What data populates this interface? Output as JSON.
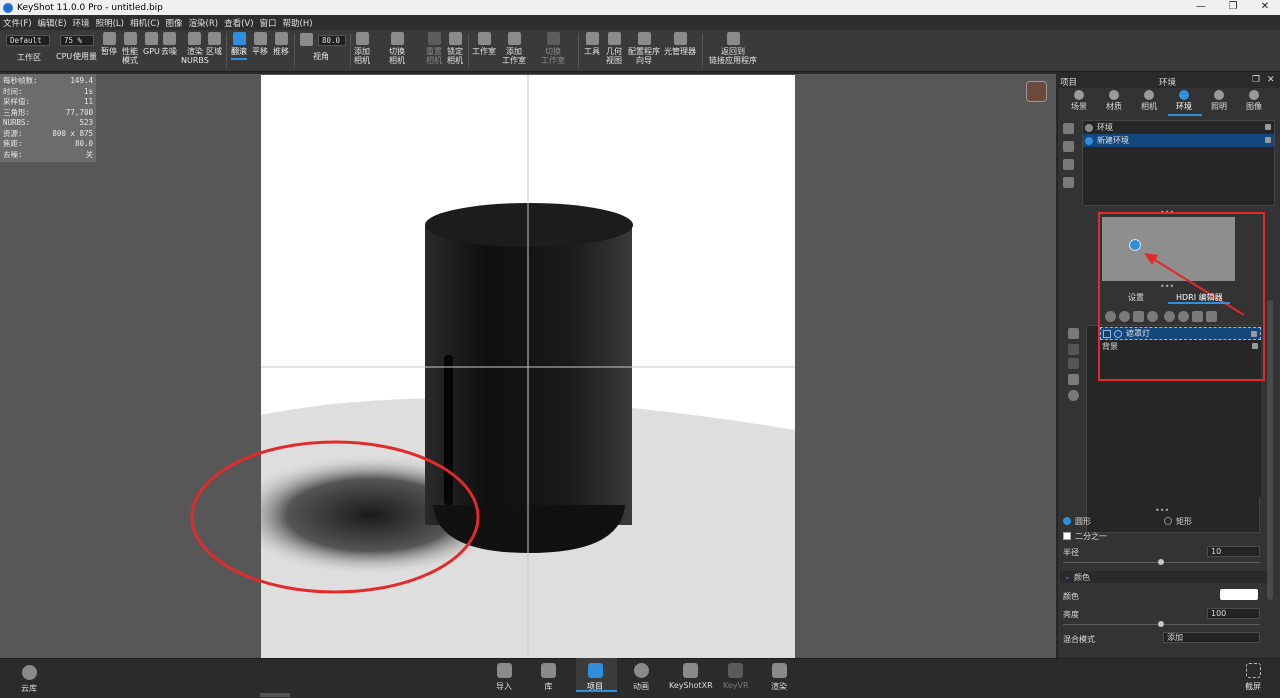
{
  "window": {
    "title": "KeyShot 11.0.0 Pro  - untitled.bip",
    "min": "—",
    "restore": "❐",
    "close": "✕"
  },
  "menu": [
    "文件(F)",
    "编辑(E)",
    "环境",
    "照明(L)",
    "相机(C)",
    "图像",
    "渲染(R)",
    "查看(V)",
    "窗口",
    "帮助(H)"
  ],
  "toolbar": {
    "preset": "Default",
    "zoom": "75 %",
    "fov": "80.0",
    "buttons": {
      "workspace": "工作区",
      "cpu": "CPU",
      "usage": "使用量",
      "pause": "暂停",
      "perf": "性能\n模式",
      "gpu": "GPU",
      "denoise": "去噪",
      "nurbs": "渲染\nNURBS",
      "region": "区域",
      "tumble": "翻滚",
      "pan": "平移",
      "dolly": "推移",
      "perspective": "视角",
      "add_camera": "添加\n相机",
      "switch_camera": "切换\n相机",
      "reset_camera": "重置\n相机",
      "lock_camera": "锁定\n相机",
      "studio": "工作室",
      "add_studio": "添加\n工作室",
      "switch_studio": "切换\n工作室",
      "tools": "工具",
      "geometry_view": "几何\n视图",
      "config_wizard": "配置程序\n向导",
      "light_manager": "光管理器",
      "back_to_app": "返回到\n链接应用程序"
    }
  },
  "stats": [
    {
      "k": "每秒帧数:",
      "v": "149.4"
    },
    {
      "k": "时间:",
      "v": "1s"
    },
    {
      "k": "采样值:",
      "v": "11"
    },
    {
      "k": "三角形:",
      "v": "77,700"
    },
    {
      "k": "NURBS:",
      "v": "523"
    },
    {
      "k": "资源:",
      "v": "800 x 875"
    },
    {
      "k": "焦距:",
      "v": "80.0"
    },
    {
      "k": "去噪:",
      "v": "关"
    }
  ],
  "panel": {
    "left_title": "项目",
    "title": "环境",
    "tabs": [
      "场景",
      "材质",
      "相机",
      "环境",
      "照明",
      "图像"
    ],
    "env_items": [
      "环境",
      "新建环境"
    ],
    "subtabs": [
      "设置",
      "HDRI 编辑器"
    ],
    "lights": [
      "遮罩灯",
      "背景"
    ],
    "shape_circle": "圆形",
    "shape_rect": "矩形",
    "half": "二分之一",
    "radius_label": "半径",
    "radius_value": "10",
    "color_section": "颜色",
    "color_label": "颜色",
    "brightness_label": "亮度",
    "brightness_value": "100",
    "blend_label": "混合模式",
    "blend_value": "添加",
    "colors": {
      "accent": "#2f8fdc",
      "selection": "#12487e",
      "annotation": "#e22a2a"
    }
  },
  "bottom": {
    "library": "云库",
    "import": "导入",
    "library2": "库",
    "project": "项目",
    "animation": "动画",
    "keyshotxr": "KeyShotXR",
    "keyvr": "KeyVR",
    "render": "渲染",
    "screenshot": "截屏"
  }
}
